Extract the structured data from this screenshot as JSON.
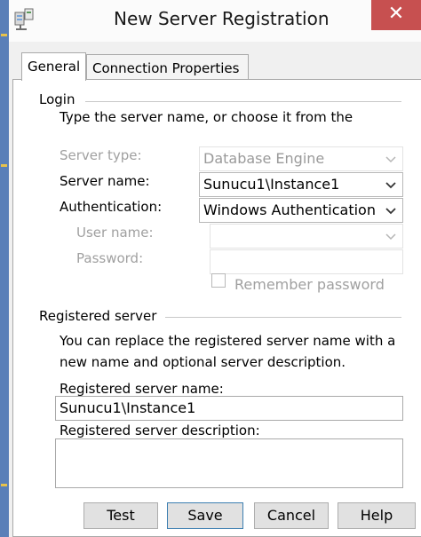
{
  "window": {
    "title": "New Server Registration",
    "close_glyph": "✕",
    "icon": "server-registration-icon"
  },
  "tabs": [
    {
      "label": "General",
      "selected": true
    },
    {
      "label": "Connection Properties",
      "selected": false
    }
  ],
  "login": {
    "group_label": "Login",
    "instruction": "Type the server name, or choose it from the",
    "server_type": {
      "label": "Server type:",
      "value": "Database Engine",
      "enabled": false
    },
    "server_name": {
      "label": "Server name:",
      "value": "Sunucu1\\Instance1",
      "enabled": true
    },
    "authentication": {
      "label": "Authentication:",
      "value": "Windows Authentication",
      "enabled": true
    },
    "user_name": {
      "label": "User name:",
      "value": "",
      "enabled": false
    },
    "password": {
      "label": "Password:",
      "value": "",
      "enabled": false
    },
    "remember_password": {
      "label": "Remember password",
      "checked": false,
      "enabled": false
    }
  },
  "registered_server": {
    "group_label": "Registered server",
    "description": [
      "You can replace the registered server name with a",
      "new name and optional server description."
    ],
    "name": {
      "label": "Registered server name:",
      "value": "Sunucu1\\Instance1"
    },
    "description_field": {
      "label": "Registered server description:",
      "value": ""
    }
  },
  "buttons": {
    "test": "Test",
    "save": "Save",
    "cancel": "Cancel",
    "help": "Help"
  },
  "colors": {
    "close_button": "#c75050",
    "disabled_text": "#a0a0a0",
    "default_button_border": "#3c7fb1"
  }
}
